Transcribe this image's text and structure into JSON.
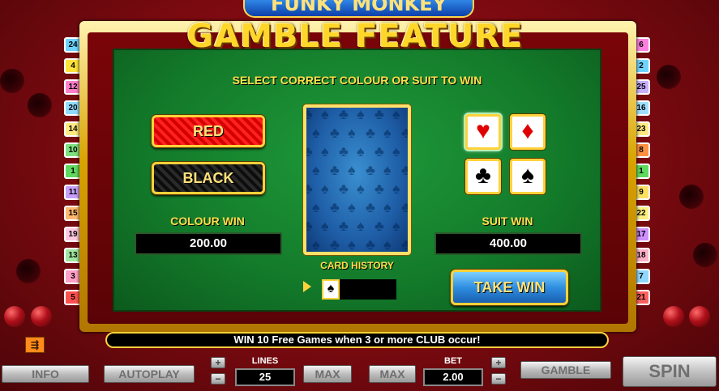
{
  "logo": {
    "text": "FUNKY MONKEY"
  },
  "title": "GAMBLE FEATURE",
  "instruction": "SELECT CORRECT COLOUR OR SUIT TO WIN",
  "colour_buttons": {
    "red": "RED",
    "black": "BLACK"
  },
  "colour_win": {
    "label": "COLOUR WIN",
    "value": "200.00"
  },
  "suit_win": {
    "label": "SUIT WIN",
    "value": "400.00"
  },
  "suits": {
    "hearts": "♥",
    "diamonds": "♦",
    "clubs": "♣",
    "spades": "♠"
  },
  "card_history": {
    "label": "CARD HISTORY",
    "cards": [
      "♠"
    ]
  },
  "take_win": "TAKE WIN",
  "info_bar": "WIN 10 Free Games when 3 or more CLUB occur!",
  "left_lines": [
    {
      "num": "24",
      "color": "#6fd3ff"
    },
    {
      "num": "4",
      "color": "#ffe23a"
    },
    {
      "num": "12",
      "color": "#ff7fc8"
    },
    {
      "num": "20",
      "color": "#8fdcff"
    },
    {
      "num": "14",
      "color": "#ffea7f"
    },
    {
      "num": "10",
      "color": "#7fe07f"
    },
    {
      "num": "1",
      "color": "#5fd95f"
    },
    {
      "num": "11",
      "color": "#c89fff"
    },
    {
      "num": "15",
      "color": "#ffb86f"
    },
    {
      "num": "19",
      "color": "#ffc8e0"
    },
    {
      "num": "13",
      "color": "#a0e8a0"
    },
    {
      "num": "3",
      "color": "#ffa0c8"
    },
    {
      "num": "5",
      "color": "#ff5050"
    }
  ],
  "right_lines": [
    {
      "num": "6",
      "color": "#ff7fe0"
    },
    {
      "num": "2",
      "color": "#6fd3ff"
    },
    {
      "num": "25",
      "color": "#c8b0ff"
    },
    {
      "num": "16",
      "color": "#9fe0ff"
    },
    {
      "num": "23",
      "color": "#ffea7f"
    },
    {
      "num": "8",
      "color": "#ff9040"
    },
    {
      "num": "1",
      "color": "#5fd95f"
    },
    {
      "num": "9",
      "color": "#ffe060"
    },
    {
      "num": "22",
      "color": "#fff07f"
    },
    {
      "num": "17",
      "color": "#d08fff"
    },
    {
      "num": "18",
      "color": "#ffb0c8"
    },
    {
      "num": "7",
      "color": "#8fd8ff"
    },
    {
      "num": "21",
      "color": "#ff6060"
    }
  ],
  "controls": {
    "info": "INFO",
    "autoplay": "AUTOPLAY",
    "lines_label": "LINES",
    "lines_value": "25",
    "max1": "MAX",
    "max2": "MAX",
    "bet_label": "BET",
    "bet_value": "2.00",
    "gamble": "GAMBLE",
    "spin": "SPIN",
    "plus": "+",
    "minus": "−"
  }
}
